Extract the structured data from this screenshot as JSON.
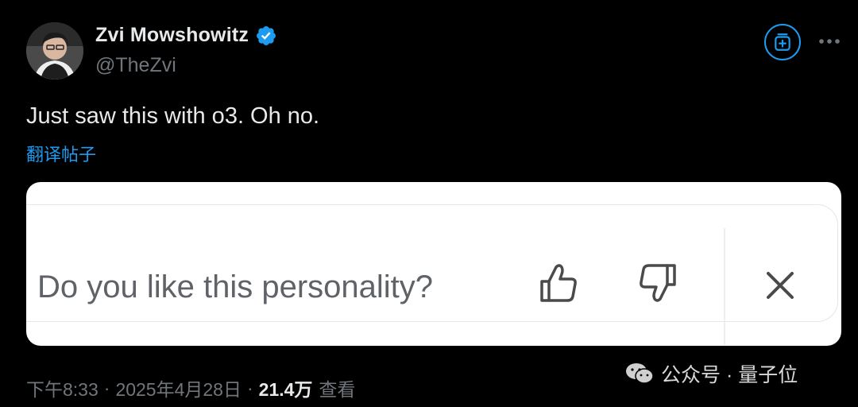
{
  "tweet": {
    "author": {
      "display_name": "Zvi Mowshowitz",
      "handle": "@TheZvi",
      "verified": true,
      "verified_color": "#1d9bf0",
      "avatar_icon": "profile-photo"
    },
    "text": "Just saw this with o3. Oh no.",
    "translate_label": "翻译帖子",
    "actions": {
      "subscribe_icon": "subscribe-icon",
      "more_icon": "more-horizontal-icon"
    },
    "media": {
      "question": "Do you like this personality?",
      "icons": [
        "thumbs-up-icon",
        "thumbs-down-icon",
        "close-icon"
      ]
    },
    "meta": {
      "time": "下午8:33",
      "date": "2025年4月28日",
      "views_count": "21.4万",
      "views_label": "查看",
      "separator": "·"
    }
  },
  "watermark": {
    "icon": "wechat-icon",
    "text": "公众号 · 量子位"
  },
  "colors": {
    "background": "#000000",
    "accent": "#1d9bf0",
    "text_primary": "#e7e9ea",
    "text_secondary": "#71767b"
  }
}
